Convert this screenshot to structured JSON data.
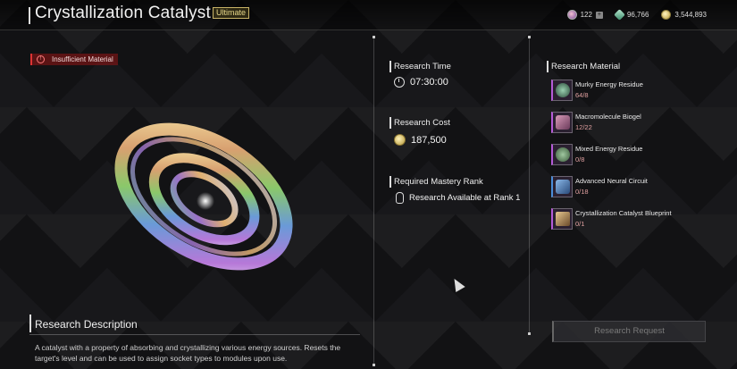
{
  "header": {
    "title": "Crystallization Catalyst",
    "grade_badge": "Ultimate"
  },
  "currencies": [
    {
      "name": "caliber",
      "icon": "caliber-gem-icon",
      "value": "122"
    },
    {
      "name": "kuiper",
      "icon": "crystal-icon",
      "value": "96,766"
    },
    {
      "name": "gold",
      "icon": "gold-coin-icon",
      "value": "3,544,893"
    }
  ],
  "status": {
    "warning": "Insufficient Material"
  },
  "research_time": {
    "label": "Research Time",
    "value": "07:30:00"
  },
  "research_cost": {
    "label": "Research Cost",
    "value": "187,500"
  },
  "mastery": {
    "label": "Required Mastery Rank",
    "value": "Research Available at Rank 1"
  },
  "materials": {
    "label": "Research Material",
    "items": [
      {
        "name": "Murky Energy Residue",
        "count": "64/8",
        "color": "#b55ad8"
      },
      {
        "name": "Macromolecule Biogel",
        "count": "12/22",
        "color": "#b55ad8"
      },
      {
        "name": "Mixed Energy Residue",
        "count": "0/8",
        "color": "#b55ad8"
      },
      {
        "name": "Advanced Neural Circuit",
        "count": "0/18",
        "color": "#4a8cd8"
      },
      {
        "name": "Crystallization Catalyst Blueprint",
        "count": "0/1",
        "color": "#b55ad8"
      }
    ]
  },
  "description": {
    "label": "Research Description",
    "text": "A catalyst with a property of absorbing and crystallizing various energy sources. Resets the target's level and can be used to assign socket types to modules upon use."
  },
  "actions": {
    "research_request": "Research Request"
  }
}
